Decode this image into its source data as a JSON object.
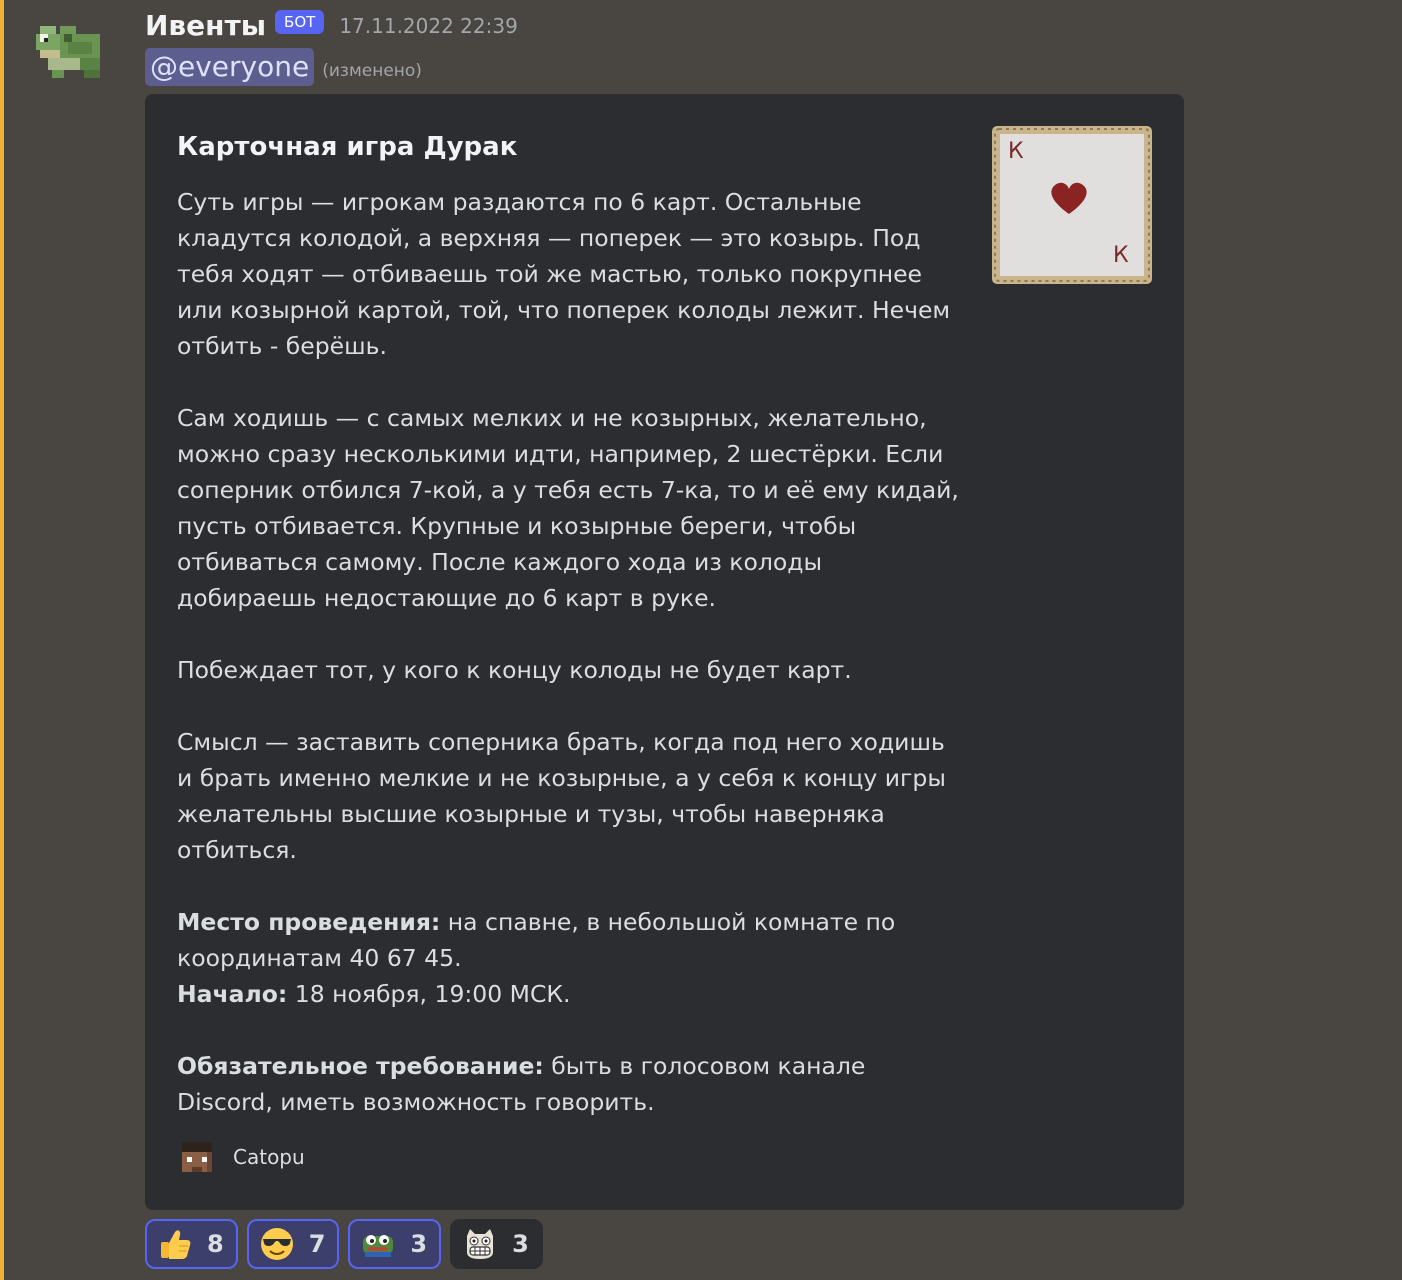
{
  "message": {
    "author": "Ивенты",
    "bot_tag": "БОТ",
    "timestamp": "17.11.2022 22:39",
    "mention": "@everyone",
    "edited": "(изменено)"
  },
  "embed": {
    "title": "Карточная игра Дурак",
    "paragraphs": [
      "Суть игры — игрокам раздаются по 6 карт. Остальные кладутся колодой, а верхняя — поперек — это козырь. Под тебя ходят — отбиваешь той же мастью, только покрупнее или козырной картой, той, что поперек колоды лежит. Нечем отбить - берёшь.",
      "Сам ходишь — с самых мелких и не козырных, желательно, можно сразу несколькими идти, например, 2 шестёрки. Если соперник отбился 7-кой, а у тебя есть 7-ка, то и её ему кидай, пусть отбивается. Крупные и козырные береги, чтобы отбиваться самому. После каждого хода из колоды добираешь недостающие до 6 карт в руке.",
      "Побеждает тот, у кого к концу колоды не будет карт.",
      "Смысл — заставить соперника брать, когда под него ходишь и брать именно мелкие и не козырные, а у себя к концу игры желательны высшие козырные и тузы, чтобы наверняка отбиться."
    ],
    "location_label": "Место проведения:",
    "location_value": " на спавне, в небольшой комнате по координатам 40 67 45.",
    "start_label": "Начало:",
    "start_value": " 18 ноября, 19:00 МСК.",
    "requirement_label": "Обязательное требование:",
    "requirement_value": " быть в голосовом канале Discord, иметь возможность говорить.",
    "thumbnail_letter_top": "К",
    "thumbnail_letter_bottom": "К",
    "footer": "Catopu"
  },
  "reactions": [
    {
      "emoji": "thumbs-up",
      "count": "8",
      "reacted": true
    },
    {
      "emoji": "sunglasses-face",
      "count": "7",
      "reacted": true
    },
    {
      "emoji": "pepe-frog",
      "count": "3",
      "reacted": true
    },
    {
      "emoji": "grinning-cat",
      "count": "3",
      "reacted": false
    }
  ],
  "colors": {
    "background": "#494540",
    "embed": "#2b2d31",
    "mention_bar": "#f0b232",
    "bot_tag": "#5865f2",
    "heart": "#8b2323"
  }
}
